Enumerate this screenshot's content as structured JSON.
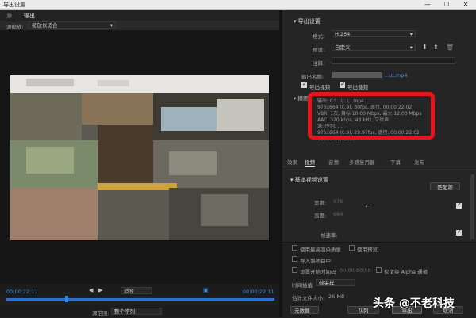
{
  "window": {
    "title": "导出设置",
    "controls": [
      "—",
      "☐",
      "✕"
    ]
  },
  "left": {
    "tabs": [
      "源",
      "输出"
    ],
    "source_scaling_label": "源缩放:",
    "source_scaling_value": "缩放以适合",
    "timecode_in": "00;00;22;11",
    "timecode_out": "00;00;22;11",
    "fit_value": "适合",
    "range_label": "源范围:",
    "range_value": "整个序列"
  },
  "export": {
    "section_title": "导出设置",
    "format_label": "格式:",
    "format_value": "H.264",
    "preset_label": "预设:",
    "preset_value": "自定义",
    "comments_label": "注释:",
    "comments_value": "",
    "output_name_label": "输出名称:",
    "output_name_value": "...ut.mp4",
    "export_video_label": "导出视频",
    "export_audio_label": "导出音频",
    "summary_label": "摘要",
    "summary_lines": [
      "输出: C:\\...\\...\\...mp4",
      "976x664 (0.9), 30fps, 逐行, 00;00;22;02",
      "VBR, 1次, 目标 10.00 Mbps, 最大 12.00 Mbps",
      "AAC, 320 kbps, 48 kHz, 立体声",
      "源: 序列, ...",
      "976x664 (0.9), 29.97fps, 逐行, 00;00;22;02",
      "48000 Hz, 立体声"
    ]
  },
  "tabs2": [
    "效果",
    "视频",
    "音频",
    "多路复用器",
    "字幕",
    "发布"
  ],
  "video": {
    "section_title": "基本视频设置",
    "match_source": "匹配源",
    "width_label": "宽度:",
    "width_value": "976",
    "height_label": "高度:",
    "height_value": "664",
    "frame_rate_label": "帧速率:"
  },
  "options": {
    "max_depth": "使用最高渲染质量",
    "use_previews": "使用预览",
    "import_project": "导入到项目中",
    "set_start_tc": "设置开始时间码",
    "start_tc_value": "00;00;00;00",
    "render_alpha": "仅渲染 Alpha 通道",
    "interp_label": "时间插值",
    "interp_value": "帧采样",
    "filesize_label": "估计文件大小:",
    "filesize_value": "26 MB"
  },
  "buttons": {
    "metadata": "元数据...",
    "queue": "队列",
    "export": "导出",
    "cancel": "取消"
  },
  "watermark": "头条 @不老科技"
}
